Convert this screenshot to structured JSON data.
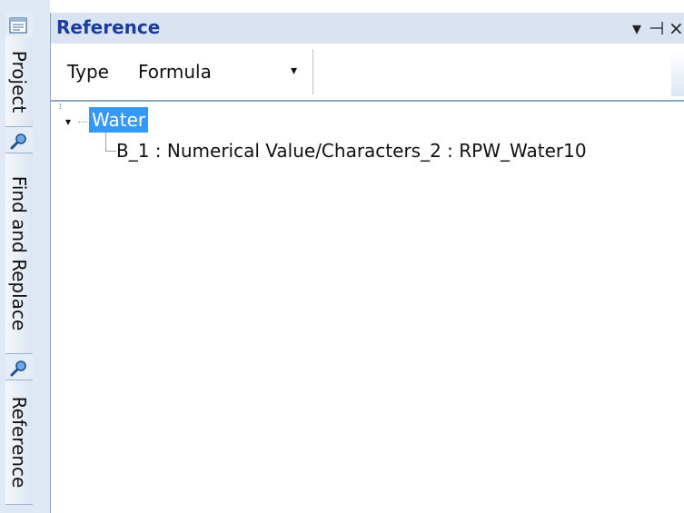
{
  "sidebar": {
    "tabs": [
      {
        "label": "Project",
        "icon": "project-grid-icon"
      },
      {
        "label": "Find and Replace",
        "icon": "magnifier-icon"
      },
      {
        "label": "Reference",
        "icon": "magnifier-icon"
      }
    ]
  },
  "panel": {
    "title": "Reference",
    "buttons": {
      "menu": "▾",
      "pin": "⊣",
      "close": "×"
    }
  },
  "toolbar": {
    "type_label": "Type",
    "type_value": "Formula",
    "dropdown_arrow": "▾"
  },
  "tree": {
    "root": {
      "label": "Water",
      "expanded": true,
      "toggle": "▾"
    },
    "children": [
      {
        "label": "B_1 : Numerical Value/Characters_2 : RPW_Water10"
      }
    ]
  },
  "colors": {
    "title_text": "#1a3c9c",
    "titlebar_bg": "#d9e3f1",
    "selection": "#3399ff",
    "dock_bg": "#dfe9f5"
  }
}
